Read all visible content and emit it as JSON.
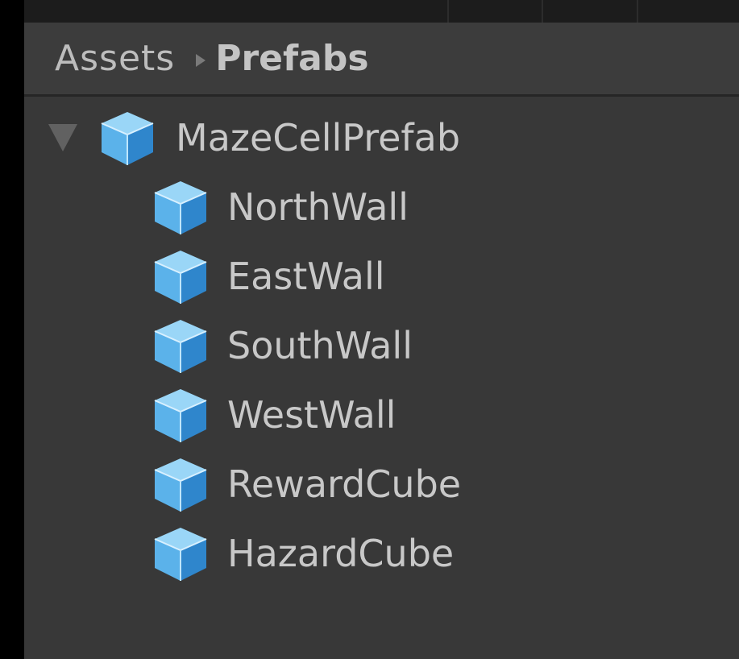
{
  "breadcrumb": {
    "root": "Assets",
    "current": "Prefabs"
  },
  "hierarchy": {
    "root": {
      "label": "MazeCellPrefab",
      "icon": "prefab-cube-icon",
      "expanded": true
    },
    "children": [
      {
        "label": "NorthWall",
        "icon": "prefab-cube-icon"
      },
      {
        "label": "EastWall",
        "icon": "prefab-cube-icon"
      },
      {
        "label": "SouthWall",
        "icon": "prefab-cube-icon"
      },
      {
        "label": "WestWall",
        "icon": "prefab-cube-icon"
      },
      {
        "label": "RewardCube",
        "icon": "prefab-cube-icon"
      },
      {
        "label": "HazardCube",
        "icon": "prefab-cube-icon"
      }
    ]
  },
  "colors": {
    "panel_bg": "#383838",
    "text": "#c8c8c8",
    "cube_light": "#8fd0f5",
    "cube_mid": "#4aa3e0",
    "cube_dark": "#2c7fc4"
  }
}
